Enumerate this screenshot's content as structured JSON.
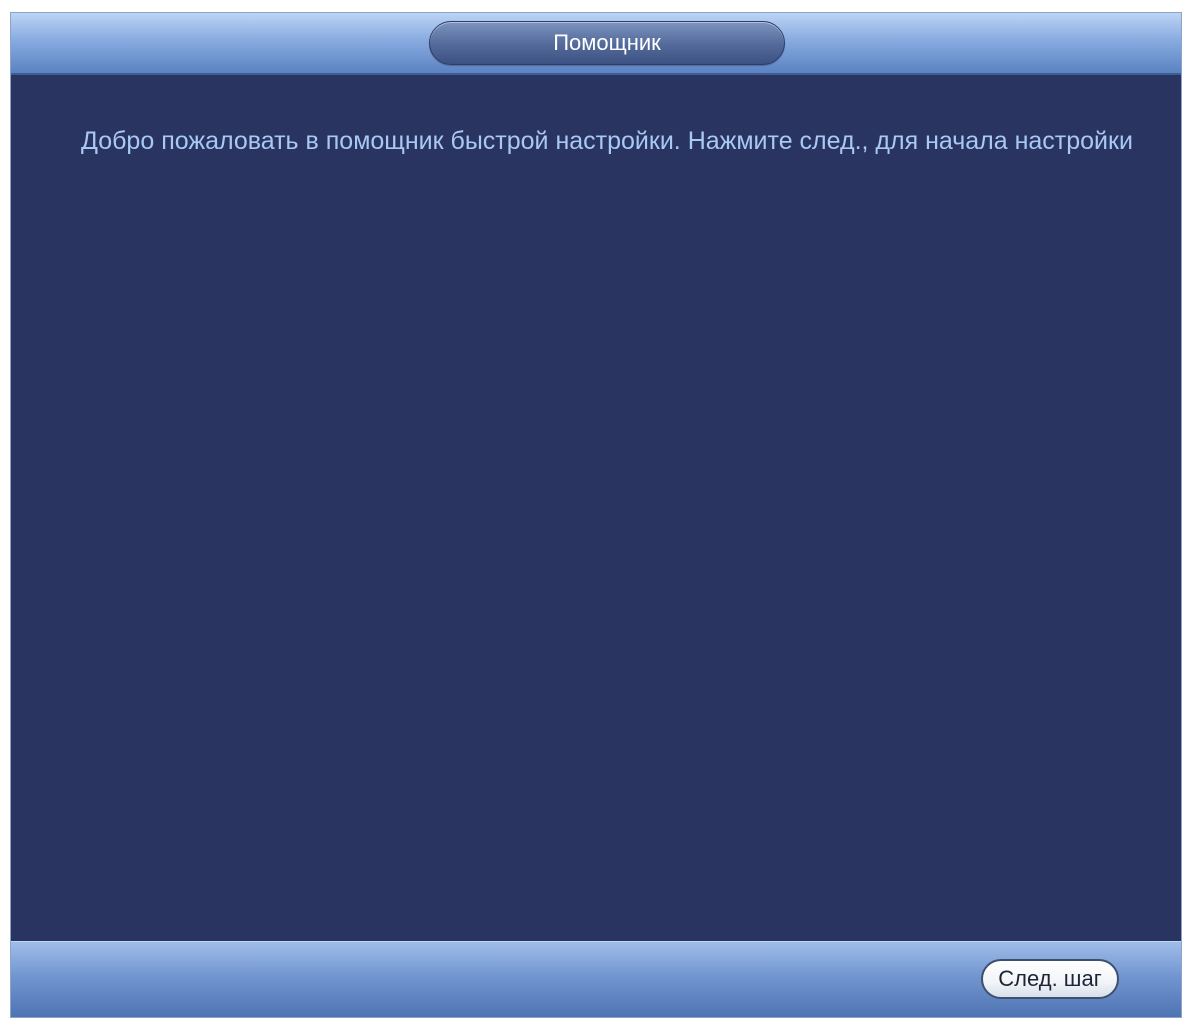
{
  "window": {
    "title": "Помощник"
  },
  "main": {
    "welcome_text": "Добро пожаловать в помощник быстрой настройки. Нажмите след., для начала настройки"
  },
  "footer": {
    "next_label": "След. шаг"
  },
  "colors": {
    "background": "#2a3460",
    "title_bar": "#88abe0",
    "text": "#a9c8f4",
    "button": "#ffffff"
  }
}
